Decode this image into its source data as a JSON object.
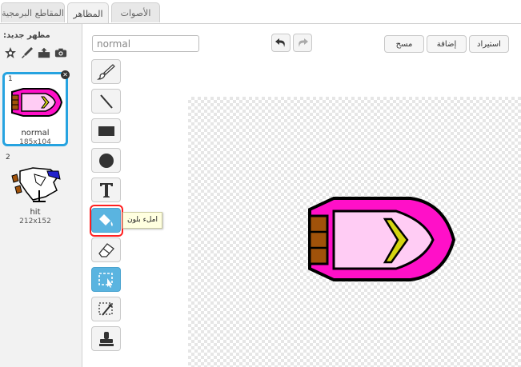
{
  "tabs": [
    {
      "label": "المقاطع البرمجية"
    },
    {
      "label": "المظاهر"
    },
    {
      "label": "الأصوات"
    }
  ],
  "sidebar": {
    "new_costume_label": "مظهر جديد:",
    "new_icons": [
      "paint-new-icon",
      "brush-icon",
      "upload-icon",
      "camera-icon"
    ],
    "costumes": [
      {
        "number": "1",
        "name": "normal",
        "size": "185x104",
        "selected": true
      },
      {
        "number": "2",
        "name": "hit",
        "size": "212x152",
        "selected": false
      }
    ]
  },
  "editor": {
    "name_value": "normal",
    "buttons": {
      "clear": "مسح",
      "add": "إضافة",
      "import": "استيراد"
    },
    "tools": [
      "brush-tool",
      "line-tool",
      "rectangle-tool",
      "ellipse-tool",
      "text-tool",
      "fill-tool",
      "eraser-tool",
      "select-tool",
      "magic-select-tool",
      "stamp-tool"
    ],
    "tooltip": "املء بلون"
  },
  "colors": {
    "accent": "#26a3e0",
    "tool_active": "#5ab4e0",
    "boat_pink": "#ff10c8",
    "boat_light": "#ffccf4",
    "boat_yellow": "#d4d410",
    "boat_brown": "#a0520a",
    "highlight": "#ff2020"
  }
}
